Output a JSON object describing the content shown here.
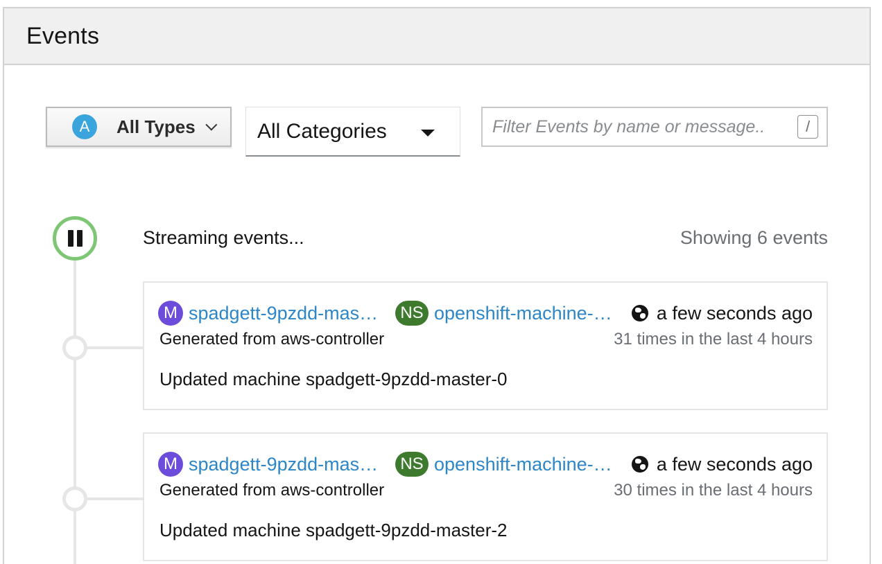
{
  "panel": {
    "title": "Events"
  },
  "toolbar": {
    "types_badge": "A",
    "types_label": "All Types",
    "categories_label": "All Categories",
    "filter_placeholder": "Filter Events by name or message..",
    "filter_shortcut": "/"
  },
  "stream": {
    "status": "Streaming events...",
    "count": "Showing 6 events"
  },
  "events": [
    {
      "resource_badge": "M",
      "resource_name": "spadgett-9pzdd-master-0",
      "namespace_badge": "NS",
      "namespace_name": "openshift-machine-api",
      "timestamp": "a few seconds ago",
      "source": "Generated from aws-controller",
      "frequency": "31 times in the last 4 hours",
      "message": "Updated machine spadgett-9pzdd-master-0"
    },
    {
      "resource_badge": "M",
      "resource_name": "spadgett-9pzdd-master-2",
      "namespace_badge": "NS",
      "namespace_name": "openshift-machine-api",
      "timestamp": "a few seconds ago",
      "source": "Generated from aws-controller",
      "frequency": "30 times in the last 4 hours",
      "message": "Updated machine spadgett-9pzdd-master-2"
    }
  ]
}
